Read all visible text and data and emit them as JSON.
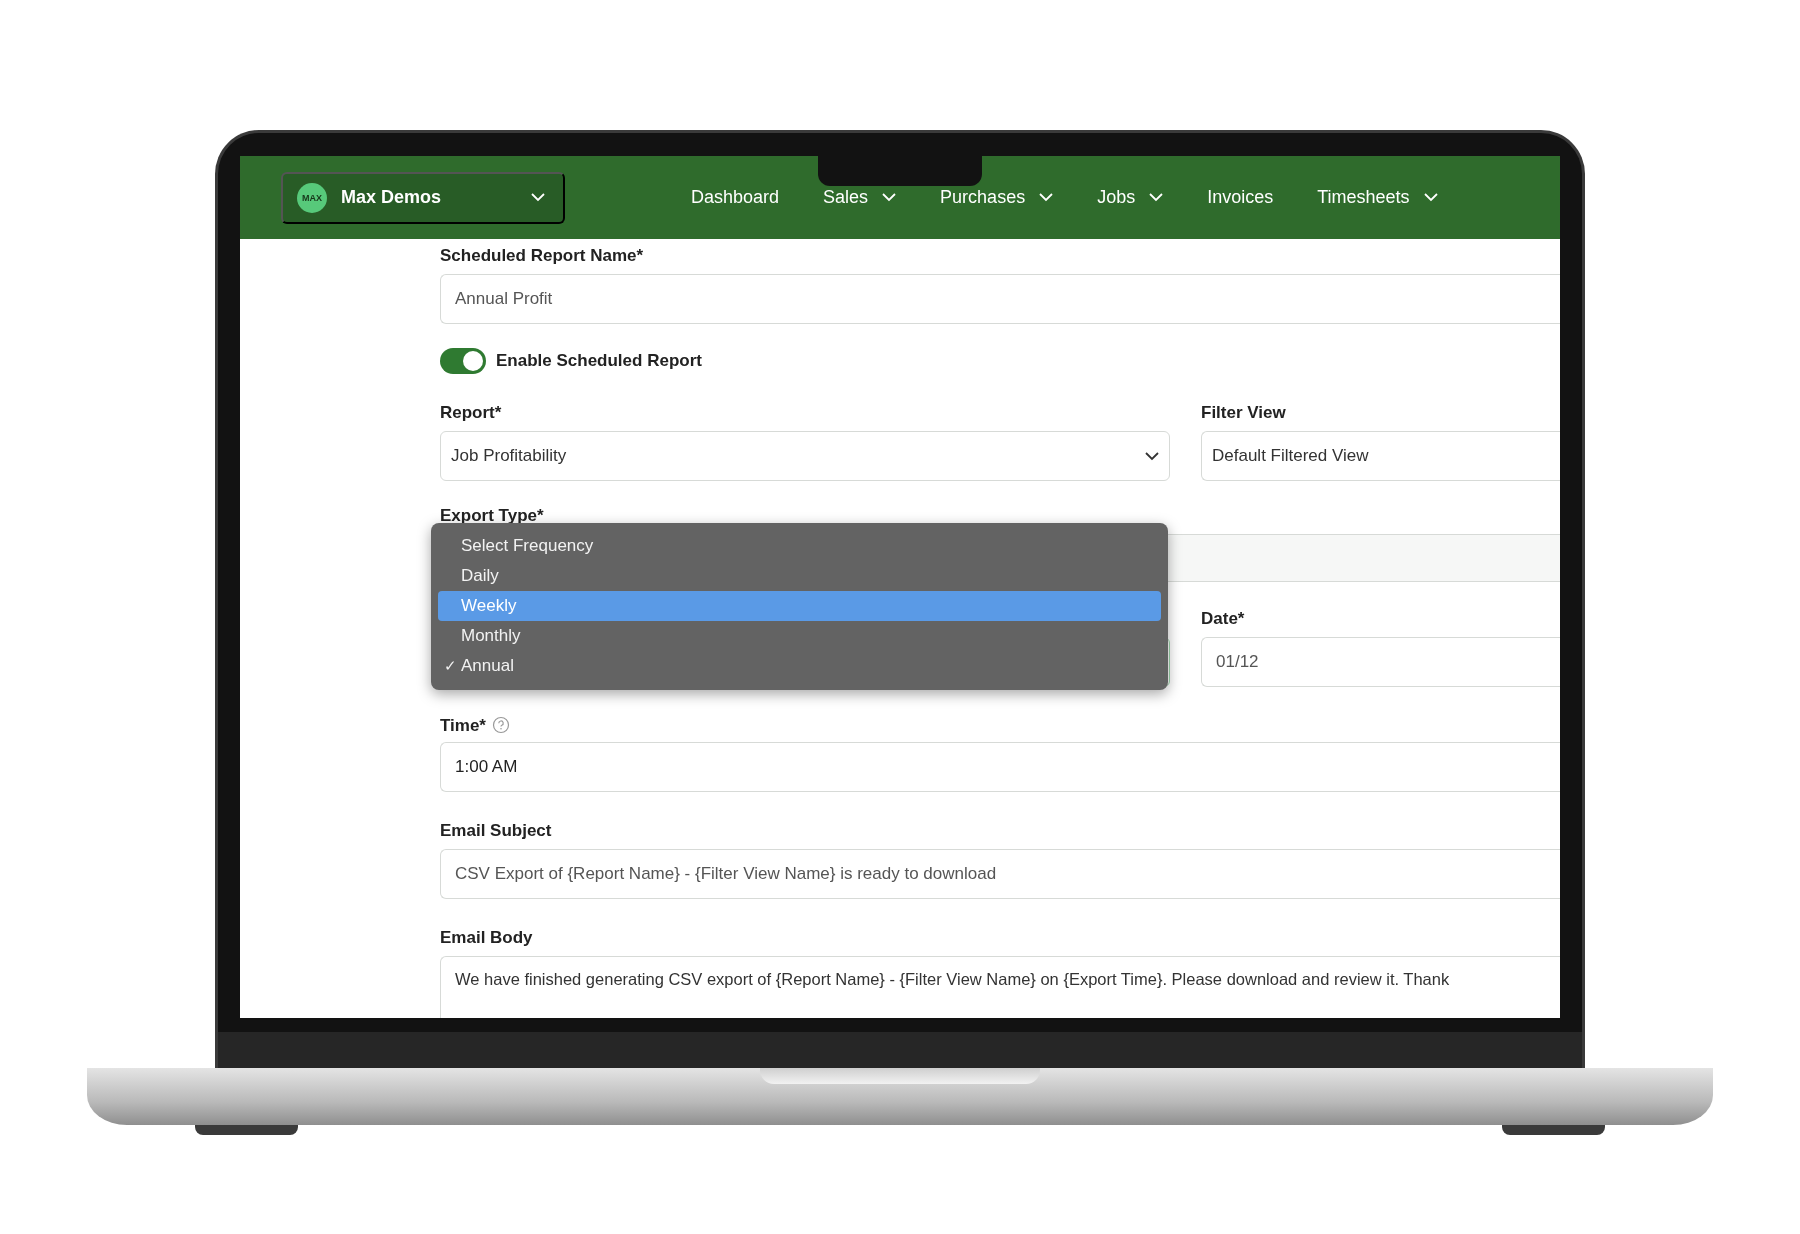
{
  "header": {
    "account": {
      "logo_text": "MAX",
      "name": "Max Demos"
    },
    "nav": [
      {
        "label": "Dashboard",
        "has_menu": false
      },
      {
        "label": "Sales",
        "has_menu": true
      },
      {
        "label": "Purchases",
        "has_menu": true
      },
      {
        "label": "Jobs",
        "has_menu": true
      },
      {
        "label": "Invoices",
        "has_menu": false
      },
      {
        "label": "Timesheets",
        "has_menu": true
      }
    ]
  },
  "form": {
    "report_name": {
      "label": "Scheduled Report Name*",
      "value": "Annual Profit"
    },
    "enable": {
      "label": "Enable Scheduled Report",
      "on": true
    },
    "report": {
      "label": "Report*",
      "value": "Job Profitability"
    },
    "filter_view": {
      "label": "Filter View",
      "value": "Default Filtered View"
    },
    "export_type": {
      "label": "Export Type*"
    },
    "frequency": {
      "options": [
        {
          "label": "Select Frequency",
          "selected": false,
          "checked": false
        },
        {
          "label": "Daily",
          "selected": false,
          "checked": false
        },
        {
          "label": "Weekly",
          "selected": true,
          "checked": false
        },
        {
          "label": "Monthly",
          "selected": false,
          "checked": false
        },
        {
          "label": "Annual",
          "selected": false,
          "checked": true
        }
      ],
      "check_mark": "✓"
    },
    "date": {
      "label": "Date*",
      "value": "01/12"
    },
    "time": {
      "label": "Time*",
      "value": "1:00 AM"
    },
    "email_subject": {
      "label": "Email Subject",
      "value": "CSV Export of {Report Name} - {Filter View Name} is ready to download"
    },
    "email_body": {
      "label": "Email Body",
      "value": "We have finished generating CSV export of {Report Name} - {Filter View Name} on {Export Time}. Please download and review it. Thank"
    }
  }
}
